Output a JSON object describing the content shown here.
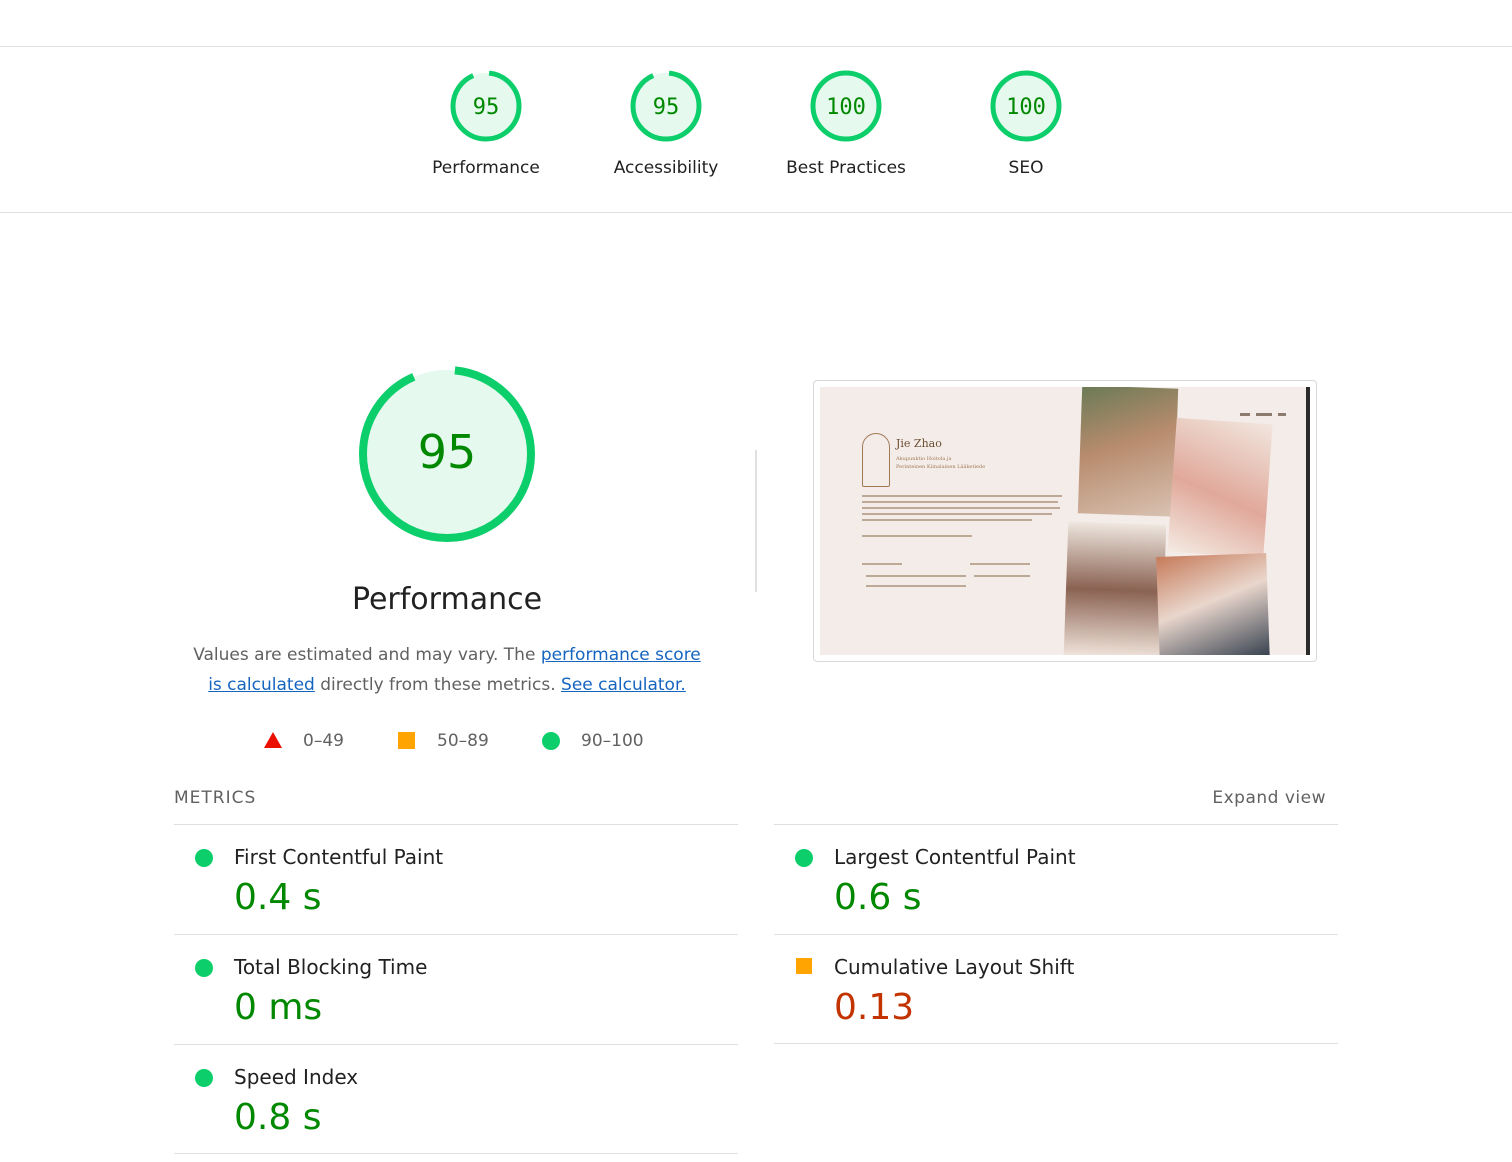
{
  "summary_gauges": [
    {
      "score": "95",
      "label": "Performance",
      "fraction": 0.95
    },
    {
      "score": "95",
      "label": "Accessibility",
      "fraction": 0.95
    },
    {
      "score": "100",
      "label": "Best Practices",
      "fraction": 1.0
    },
    {
      "score": "100",
      "label": "SEO",
      "fraction": 1.0
    }
  ],
  "performance": {
    "score": "95",
    "fraction": 0.95,
    "title": "Performance",
    "desc_prefix": "Values are estimated and may vary. The ",
    "desc_link1": "performance score is calculated",
    "desc_mid": " directly from these metrics. ",
    "desc_link2": "See calculator."
  },
  "legend": {
    "fail": "0–49",
    "average": "50–89",
    "pass": "90–100"
  },
  "screenshot": {
    "site_name": "Jie Zhao",
    "site_sub_1": "Akupunktio Hoitola ja",
    "site_sub_2": "Perinteinen Kiinalainen Lääketiede"
  },
  "metrics": {
    "title": "METRICS",
    "expand_label": "Expand view",
    "fcp": {
      "name": "First Contentful Paint",
      "value": "0.4 s"
    },
    "lcp": {
      "name": "Largest Contentful Paint",
      "value": "0.6 s"
    },
    "tbt": {
      "name": "Total Blocking Time",
      "value": "0 ms"
    },
    "cls": {
      "name": "Cumulative Layout Shift",
      "value": "0.13"
    },
    "si": {
      "name": "Speed Index",
      "value": "0.8 s"
    }
  },
  "colors": {
    "pass": "#0cce6b",
    "pass_text": "#008800",
    "average": "#ffa400",
    "fail": "#eb0f00",
    "average_text": "#c33300",
    "gauge_fill": "#e5f9ee"
  }
}
